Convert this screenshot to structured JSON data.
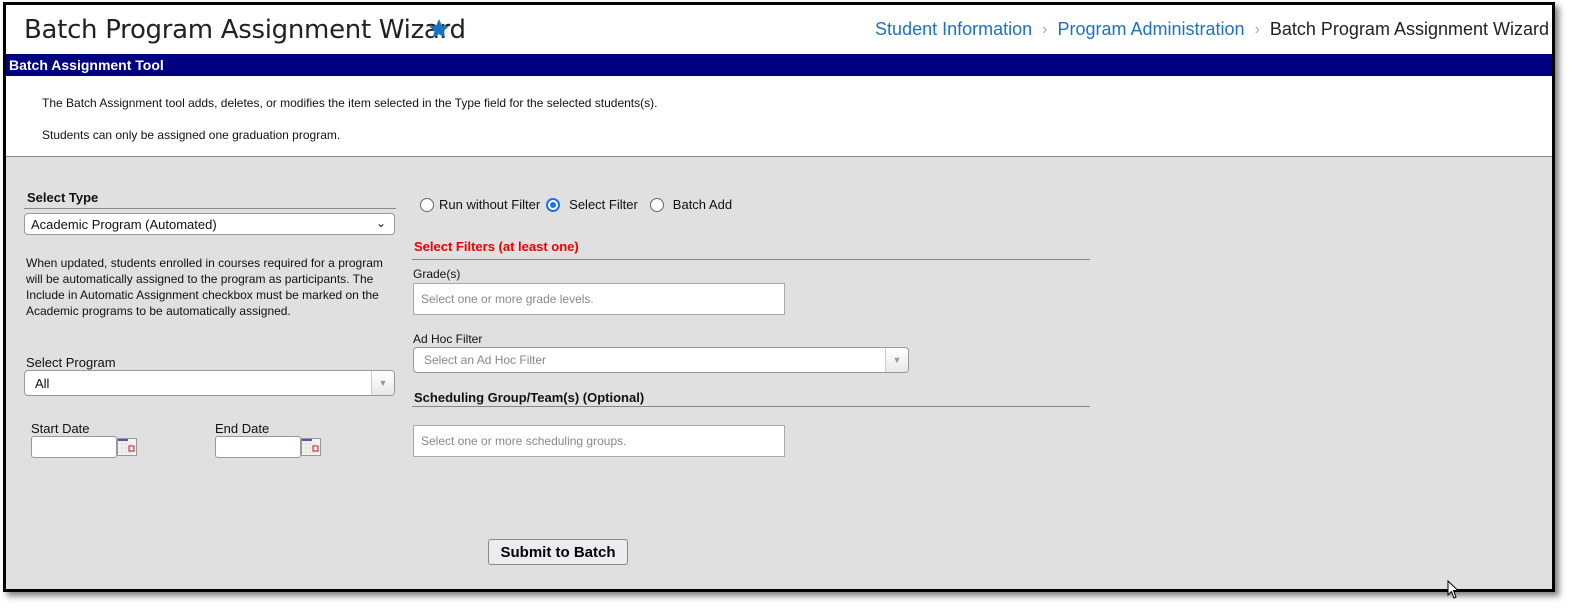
{
  "header": {
    "title": "Batch Program Assignment Wizard",
    "star_icon": "star-icon",
    "accent_color": "#1a73c0",
    "breadcrumb": [
      "Student Information",
      "Program Administration",
      "Batch Program Assignment Wizard"
    ]
  },
  "section_bar": {
    "title": "Batch Assignment Tool",
    "color": "#000080"
  },
  "info": {
    "line1": "The Batch Assignment tool adds, deletes, or modifies the item selected in the Type field for the selected students(s).",
    "line2": "Students can only be assigned one graduation program."
  },
  "left": {
    "select_type_label": "Select Type",
    "select_type_value": "Academic Program (Automated)",
    "description": "When updated, students enrolled in courses required for a program will be automatically assigned to the program as participants. The Include in Automatic Assignment checkbox must be marked on the Academic programs to be automatically assigned.",
    "select_program_label": "Select Program",
    "select_program_value": "All",
    "start_date_label": "Start Date",
    "start_date_value": "",
    "end_date_label": "End Date",
    "end_date_value": ""
  },
  "right": {
    "radios": [
      {
        "label": "Run without Filter",
        "checked": false
      },
      {
        "label": "Select Filter",
        "checked": true
      },
      {
        "label": "Batch Add",
        "checked": false
      }
    ],
    "filters_heading": "Select Filters (at least one)",
    "grades_label": "Grade(s)",
    "grades_placeholder": "Select one or more grade levels.",
    "adhoc_label": "Ad Hoc Filter",
    "adhoc_placeholder": "Select an Ad Hoc Filter",
    "scheduling_heading": "Scheduling Group/Team(s) (Optional)",
    "scheduling_placeholder": "Select one or more scheduling groups."
  },
  "submit_label": "Submit to Batch"
}
